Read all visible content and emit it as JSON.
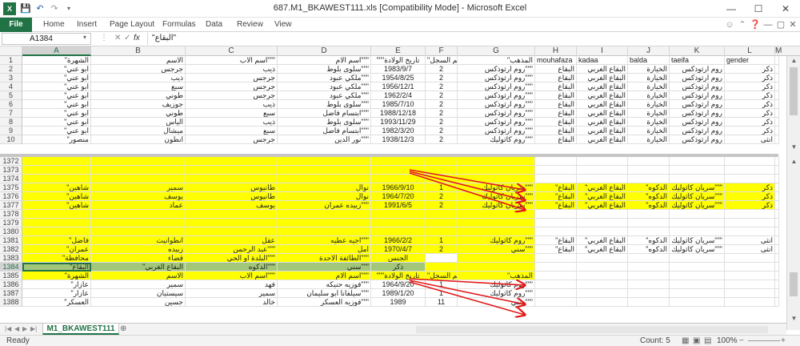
{
  "window": {
    "title": "687.M1_BKAWEST111.xls  [Compatibility Mode]  -  Microsoft Excel"
  },
  "ribbon": {
    "file": "File",
    "tabs": [
      "Home",
      "Insert",
      "Page Layout",
      "Formulas",
      "Data",
      "Review",
      "View"
    ]
  },
  "formula_bar": {
    "name_box": "A1384",
    "fx": "fx",
    "value": "\"البقاع\""
  },
  "columns": [
    "A",
    "B",
    "C",
    "D",
    "E",
    "F",
    "G",
    "H",
    "I",
    "J",
    "K",
    "L",
    "M"
  ],
  "sheet": {
    "tab": "M1_BKAWEST111"
  },
  "status": {
    "ready": "Ready",
    "count": "Count: 5",
    "zoom": "100%"
  },
  "rows": [
    {
      "n": "1",
      "cells": [
        "الشهرة\"",
        "الاسم",
        "\"\"\"اسم الاب",
        "\"\"\"اسم الام",
        "\"\"\"تاريخ الولادة",
        "\"رقم السجل",
        "المذهب\"",
        "mouhafaza",
        "kadaa",
        "balda",
        "taeifa",
        "gender",
        ""
      ]
    },
    {
      "n": "2",
      "cells": [
        "ابو عني\"",
        "جرجس",
        "ذيب",
        "\"\"\"سلوى بلوط",
        "1983/9/7",
        "2",
        "\"\"\"روم ارثوذكس",
        "البقاع",
        "البقاع الغربي",
        "الخيارة",
        "روم ارثوذكس",
        "ذكر",
        ""
      ]
    },
    {
      "n": "3",
      "cells": [
        "ابو عني\"",
        "ذيب",
        "جرجس",
        "\"\"\"ملكي عبود",
        "1954/8/25",
        "2",
        "\"\"\"روم ارثوذكس",
        "البقاع",
        "البقاع الغربي",
        "الخيارة",
        "روم ارثوذكس",
        "ذكر",
        ""
      ]
    },
    {
      "n": "4",
      "cells": [
        "ابو عني\"",
        "سبع",
        "جرجس",
        "\"\"\"ملكي عبود",
        "1956/12/1",
        "2",
        "\"\"\"روم ارثوذكس",
        "البقاع",
        "البقاع الغربي",
        "الخيارة",
        "روم ارثوذكس",
        "ذكر",
        ""
      ]
    },
    {
      "n": "5",
      "cells": [
        "ابو عني\"",
        "طوني",
        "جرجس",
        "\"\"\"ملكي عبود",
        "1962/2/4",
        "2",
        "\"\"\"روم ارثوذكس",
        "البقاع",
        "البقاع الغربي",
        "الخيارة",
        "روم ارثوذكس",
        "ذكر",
        ""
      ]
    },
    {
      "n": "6",
      "cells": [
        "ابو عني\"",
        "جوزيف",
        "ذيب",
        "\"\"\"سلوى بلوط",
        "1985/7/10",
        "2",
        "\"\"\"روم ارثوذكس",
        "البقاع",
        "البقاع الغربي",
        "الخيارة",
        "روم ارثوذكس",
        "ذكر",
        ""
      ]
    },
    {
      "n": "7",
      "cells": [
        "ابو عني\"",
        "طوني",
        "سبع",
        "\"\"\"ابتسام فاضل",
        "1988/12/18",
        "2",
        "\"\"\"روم ارثوذكس",
        "البقاع",
        "البقاع الغربي",
        "الخيارة",
        "روم ارثوذكس",
        "ذكر",
        ""
      ]
    },
    {
      "n": "8",
      "cells": [
        "ابو عني\"",
        "الياس",
        "ذيب",
        "\"\"\"سلوى بلوط",
        "1993/11/29",
        "2",
        "\"\"\"روم ارثوذكس",
        "البقاع",
        "البقاع الغربي",
        "الخيارة",
        "روم ارثوذكس",
        "ذكر",
        ""
      ]
    },
    {
      "n": "9",
      "cells": [
        "ابو عني\"",
        "ميشال",
        "سبع",
        "\"\"\"ابتسام فاضل",
        "1982/3/20",
        "2",
        "\"\"\"روم ارثوذكس",
        "البقاع",
        "البقاع الغربي",
        "الخيارة",
        "روم ارثوذكس",
        "ذكر",
        ""
      ]
    },
    {
      "n": "10",
      "cells": [
        "منصور\"",
        "انطون",
        "جرجس",
        "\"\"\"نور الدين",
        "1938/12/3",
        "2",
        "\"\"\"روم كاثوليك",
        "البقاع",
        "البقاع الغربي",
        "الخيارة",
        "روم ارثوذكس",
        "انثى",
        ""
      ]
    },
    {
      "n": "1372",
      "cells": [
        "",
        "",
        "",
        "",
        "",
        "",
        "",
        "",
        "",
        "",
        "",
        "",
        ""
      ]
    },
    {
      "n": "1373",
      "cells": [
        "",
        "",
        "",
        "",
        "",
        "",
        "",
        "",
        "",
        "",
        "",
        "",
        ""
      ]
    },
    {
      "n": "1374",
      "cells": [
        "",
        "",
        "",
        "",
        "",
        "",
        "",
        "",
        "",
        "",
        "",
        "",
        ""
      ]
    },
    {
      "n": "1375",
      "cells": [
        "شاهين\"",
        "سمير",
        "طانيوس",
        "نوال",
        "1966/9/10",
        "1",
        "\"\"\"سريان كاثوليك",
        "البقاع\"",
        "البقاع الغربي\"",
        "الدكوه\"",
        "\"\"\"سريان كاثوليك",
        "ذكر",
        ""
      ]
    },
    {
      "n": "1376",
      "cells": [
        "شاهين\"",
        "يوسف",
        "طانيوس",
        "نوال",
        "1964/7/20",
        "2",
        "\"\"\"سريان كاثوليك",
        "البقاع\"",
        "البقاع الغربي\"",
        "الدكوه\"",
        "\"\"\"سريان كاثوليك",
        "ذكر",
        ""
      ]
    },
    {
      "n": "1377",
      "cells": [
        "شاهين\"",
        "عماد",
        "يوسف",
        "\"\"\"زبيده عمران",
        "1991/6/5",
        "2",
        "\"\"\"سريان كاثوليك",
        "البقاع\"",
        "البقاع الغربي\"",
        "الدكوه\"",
        "\"\"\"سريان كاثوليك",
        "ذكر",
        ""
      ]
    },
    {
      "n": "1378",
      "cells": [
        "",
        "",
        "",
        "",
        "",
        "",
        "",
        "",
        "",
        "",
        "",
        "",
        ""
      ]
    },
    {
      "n": "1379",
      "cells": [
        "",
        "",
        "",
        "",
        "",
        "",
        "",
        "",
        "",
        "",
        "",
        "",
        ""
      ]
    },
    {
      "n": "1380",
      "cells": [
        "",
        "",
        "",
        "",
        "",
        "",
        "",
        "",
        "",
        "",
        "",
        "",
        ""
      ]
    },
    {
      "n": "1381",
      "cells": [
        "فاضل\"",
        "انطوانيت",
        "عقل",
        "\"\"\"اجيه عطيه",
        "1966/2/2",
        "1",
        "\"\"\"روم كاثوليك",
        "البقاع\"",
        "البقاع الغربي\"",
        "الدكوه\"",
        "\"\"\"سريان كاثوليك",
        "انثى",
        ""
      ]
    },
    {
      "n": "1382",
      "cells": [
        "عمران\"",
        "زبيده",
        "\"\"\"عبد الرحمن",
        "امل",
        "1970/4/7",
        "2",
        "\"\"\"سني",
        "البقاع\"",
        "البقاع الغربي\"",
        "الدكوه\"",
        "\"\"\"سريان كاثوليك",
        "انثى",
        ""
      ]
    },
    {
      "n": "1383",
      "cells": [
        "محافظة\"",
        "قضاء",
        "\"\"\"البلدة او الحي",
        "\"\"\"الطائفة الاحدة",
        "الجنس",
        "",
        "",
        "",
        "",
        "",
        "",
        "",
        ""
      ]
    },
    {
      "n": "1384",
      "cells": [
        "البقاع\"",
        "البقاع الغربي\"",
        "\"\"\"الدكوه",
        "\"\"\"سني",
        "ذكر",
        "",
        "",
        "",
        "",
        "",
        "",
        "",
        ""
      ]
    },
    {
      "n": "1385",
      "cells": [
        "الشهرة\"",
        "الاسم",
        "\"\"\"اسم الاب",
        "\"\"\"اسم الام",
        "\"\"\"تاريخ الولادة",
        "\"رقم السجل",
        "المذهب\"",
        "",
        "",
        "",
        "",
        "",
        ""
      ]
    },
    {
      "n": "1386",
      "cells": [
        "عازار\"",
        "سمير",
        "فهد",
        "\"\"\"فوزيه حنيكه",
        "1964/9/20",
        "1",
        "\"\"\"روم كاثوليك",
        "",
        "",
        "",
        "",
        "",
        ""
      ]
    },
    {
      "n": "1387",
      "cells": [
        "عازار\"",
        "سيستيان",
        "سمير",
        "\"\"\"سيلفانا ابو سليمان",
        "1989/1/20",
        "1",
        "\"\"\"روم كاثوليك",
        "",
        "",
        "",
        "",
        "",
        ""
      ]
    },
    {
      "n": "1388",
      "cells": [
        "العسكر\"",
        "جسين",
        "خالد",
        "\"\"\"فوزيه العسكر",
        "1989",
        "11",
        "\"\"\"سني",
        "",
        "",
        "",
        "",
        "",
        ""
      ]
    }
  ]
}
